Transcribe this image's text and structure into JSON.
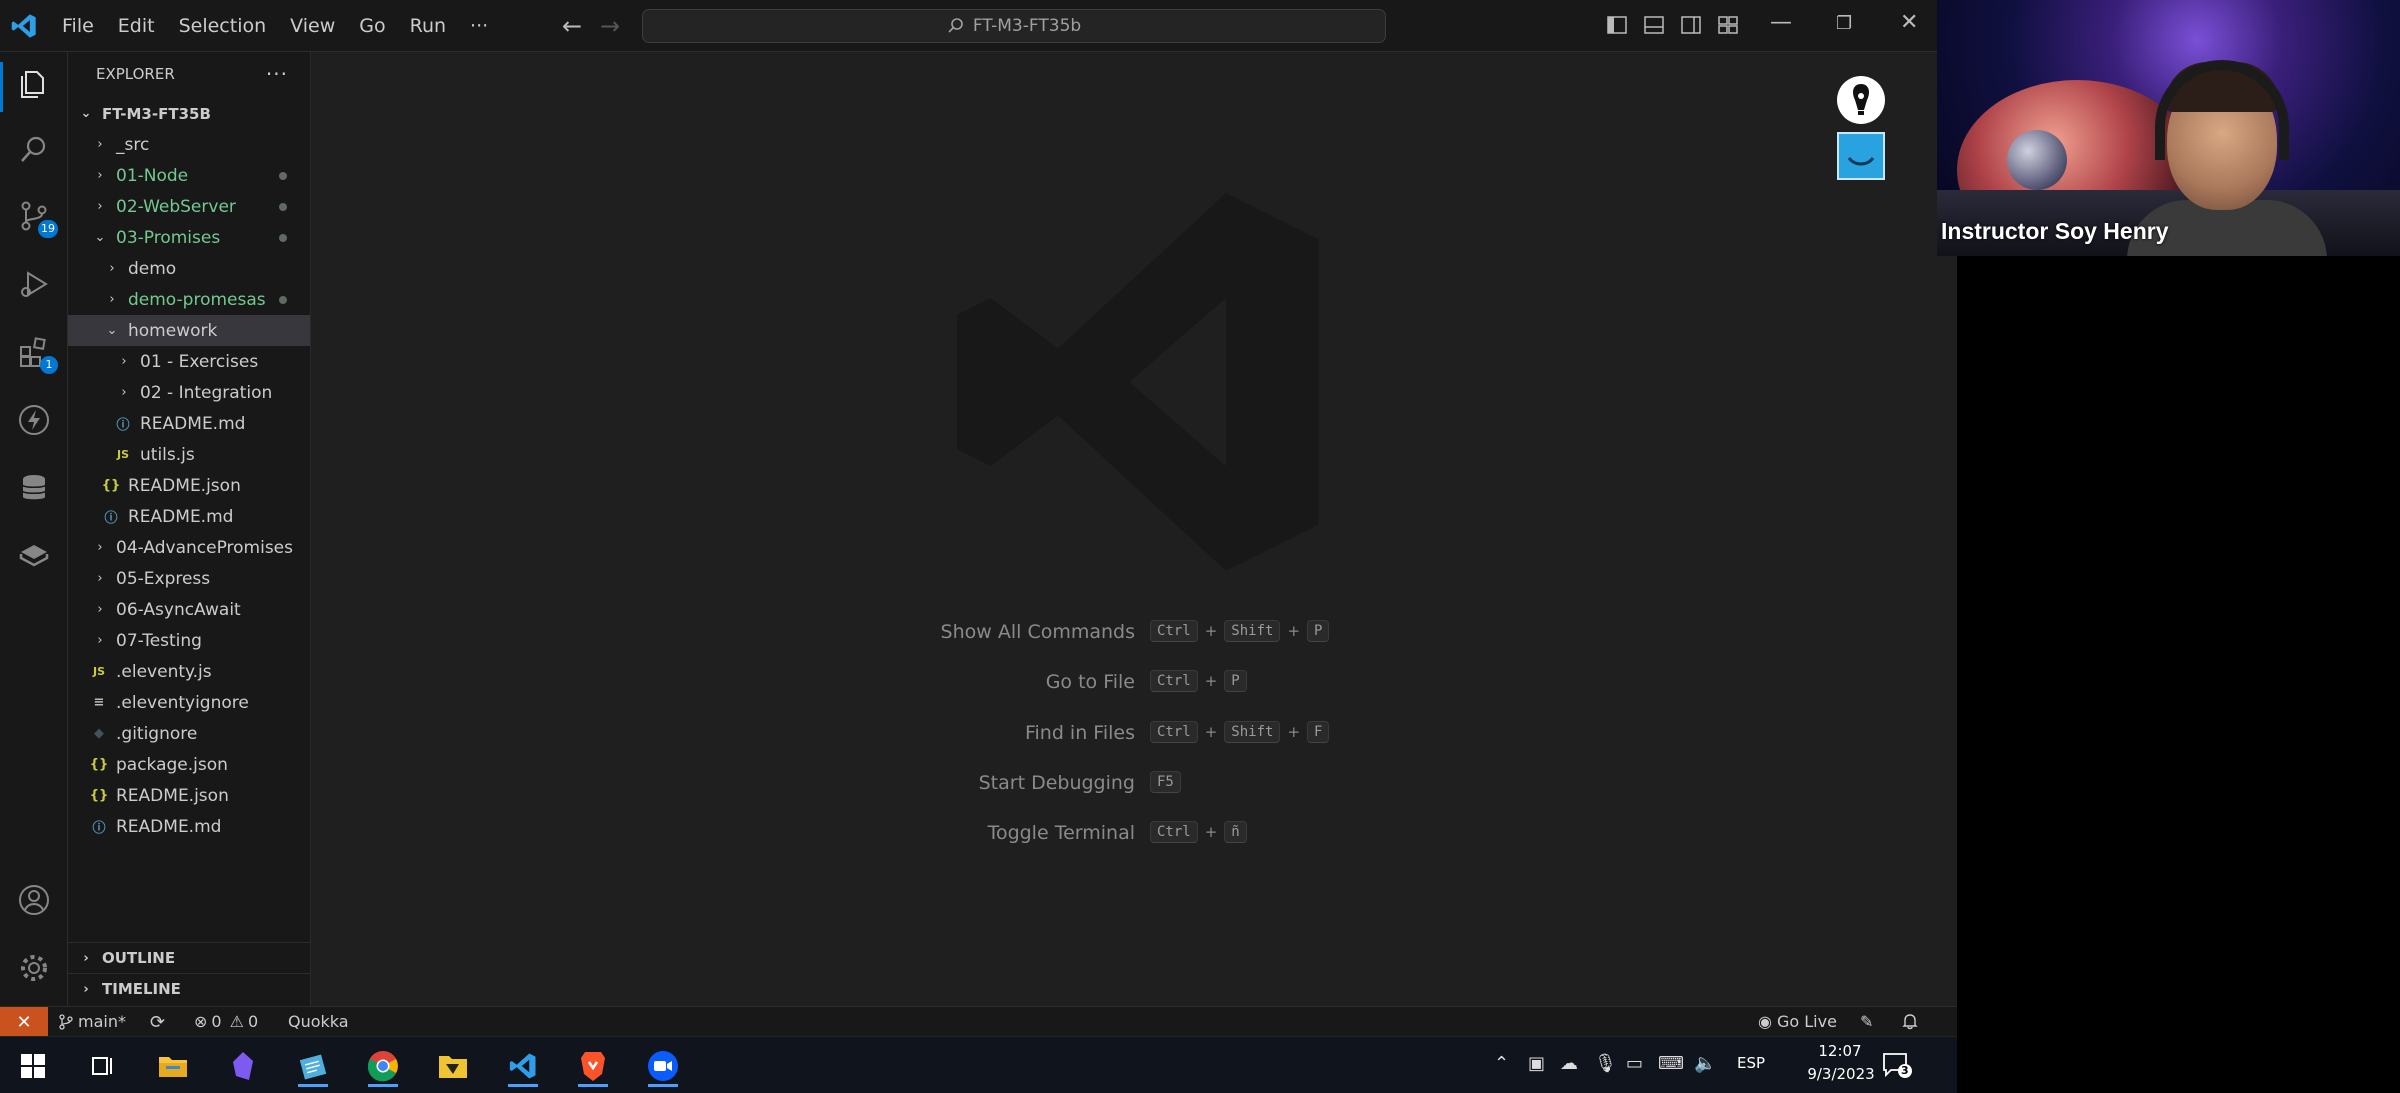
{
  "titlebar": {
    "menus": [
      "File",
      "Edit",
      "Selection",
      "View",
      "Go",
      "Run",
      "···"
    ],
    "command_center": "FT-M3-FT35b"
  },
  "activity": {
    "scm_badge": "19",
    "extensions_badge": "1"
  },
  "explorer": {
    "header": "EXPLORER",
    "more": "···",
    "root": "FT-M3-FT35B",
    "items": [
      {
        "label": "_src"
      },
      {
        "label": "01-Node"
      },
      {
        "label": "02-WebServer"
      },
      {
        "label": "03-Promises"
      },
      {
        "label": "demo"
      },
      {
        "label": "demo-promesas"
      },
      {
        "label": "homework"
      },
      {
        "label": "01 - Exercises"
      },
      {
        "label": "02 - Integration"
      },
      {
        "label": "README.md"
      },
      {
        "label": "utils.js"
      },
      {
        "label": "README.json"
      },
      {
        "label": "README.md"
      },
      {
        "label": "04-AdvancePromises"
      },
      {
        "label": "05-Express"
      },
      {
        "label": "06-AsyncAwait"
      },
      {
        "label": "07-Testing"
      },
      {
        "label": ".eleventy.js"
      },
      {
        "label": ".eleventyignore"
      },
      {
        "label": ".gitignore"
      },
      {
        "label": "package.json"
      },
      {
        "label": "README.json"
      },
      {
        "label": "README.md"
      }
    ],
    "icons": {
      "js": "JS",
      "json": "{}",
      "info": "ⓘ",
      "ignore": "◆",
      "list": "≡"
    },
    "outline": "OUTLINE",
    "timeline": "TIMELINE"
  },
  "shortcuts": [
    {
      "label": "Show All Commands",
      "keys": [
        "Ctrl",
        "Shift",
        "P"
      ]
    },
    {
      "label": "Go to File",
      "keys": [
        "Ctrl",
        "P"
      ]
    },
    {
      "label": "Find in Files",
      "keys": [
        "Ctrl",
        "Shift",
        "F"
      ]
    },
    {
      "label": "Start Debugging",
      "keys": [
        "F5"
      ]
    },
    {
      "label": "Toggle Terminal",
      "keys": [
        "Ctrl",
        "ñ"
      ]
    }
  ],
  "shortcut_plus": "+",
  "statusbar": {
    "branch": "main*",
    "errors": "0",
    "warnings": "0",
    "quokka": "Quokka",
    "golive": "Go Live"
  },
  "webcam": {
    "name": "Instructor Soy Henry"
  },
  "taskbar": {
    "lang": "ESP",
    "time": "12:07",
    "date": "9/3/2023",
    "notifications": "3"
  },
  "colors": {
    "accent": "#0078d4",
    "git_added": "#73c991",
    "remote": "#c9521e"
  }
}
